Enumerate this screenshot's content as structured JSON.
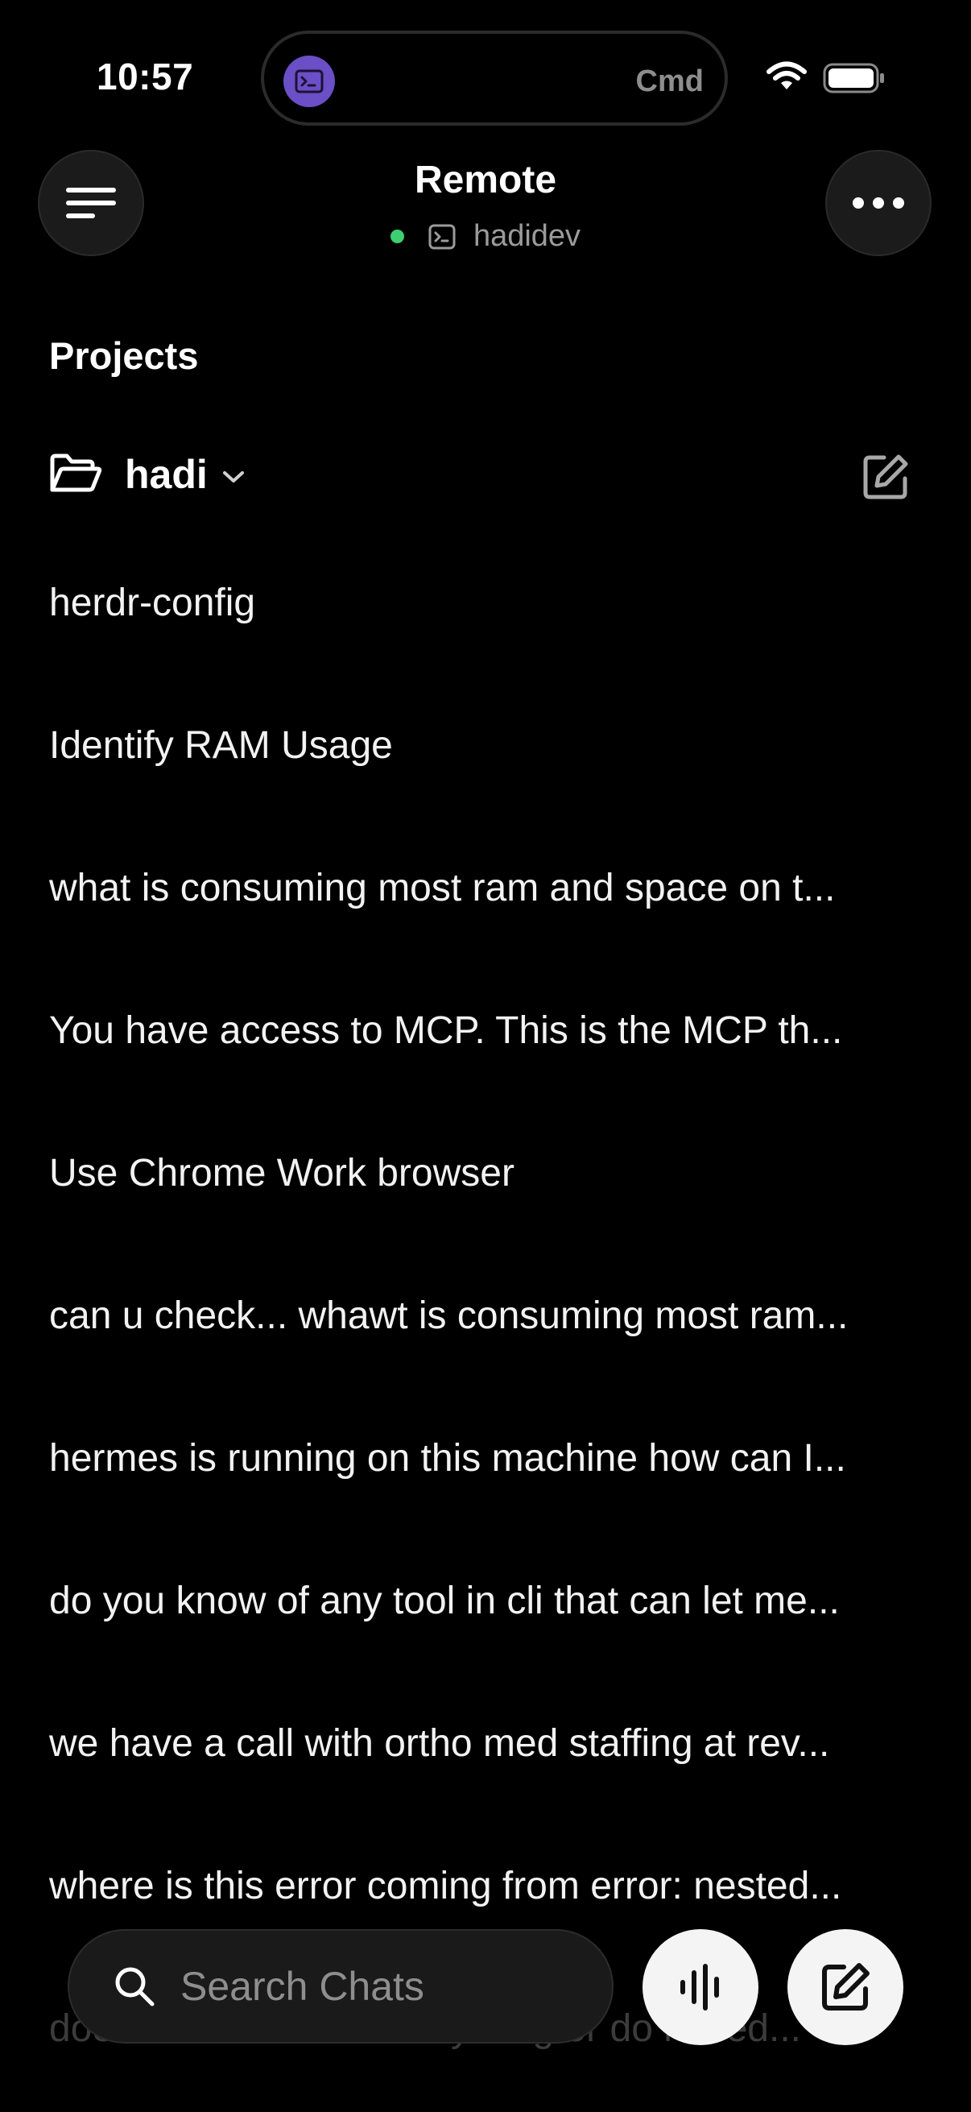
{
  "status_bar": {
    "time": "10:57",
    "island_label": "Cmd",
    "icons": [
      "terminal-app-icon",
      "wifi-icon",
      "battery-icon"
    ]
  },
  "header": {
    "title": "Remote",
    "host": "hadidev",
    "connection_status_color": "#3ecf72",
    "icons": [
      "menu-icon",
      "more-icon",
      "terminal-icon"
    ]
  },
  "projects": {
    "section_title": "Projects",
    "current_project": "hadi",
    "icons": [
      "folder-open-icon",
      "chevron-down-icon",
      "edit-icon"
    ]
  },
  "chats": [
    "herdr-config",
    "Identify RAM Usage",
    "what is consuming most ram and space on t...",
    "You have access to MCP. This is the MCP th...",
    "Use Chrome Work browser",
    "can u check... whawt is consuming most ram...",
    "hermes is running on this machine how can I...",
    "do you know of any tool in cli that can let me...",
    "we have a call with ortho med staffing at rev...",
    "where is this error coming from error: nested...",
    "does this need to do anything or do i need..."
  ],
  "bottom_bar": {
    "search_placeholder": "Search Chats",
    "icons": [
      "search-icon",
      "voice-waveform-icon",
      "new-chat-icon"
    ]
  },
  "colors": {
    "background": "#000000",
    "accent_purple": "#6a4fc6",
    "button_surface": "#1b1b1b",
    "fab_surface": "#f4f4f4"
  }
}
